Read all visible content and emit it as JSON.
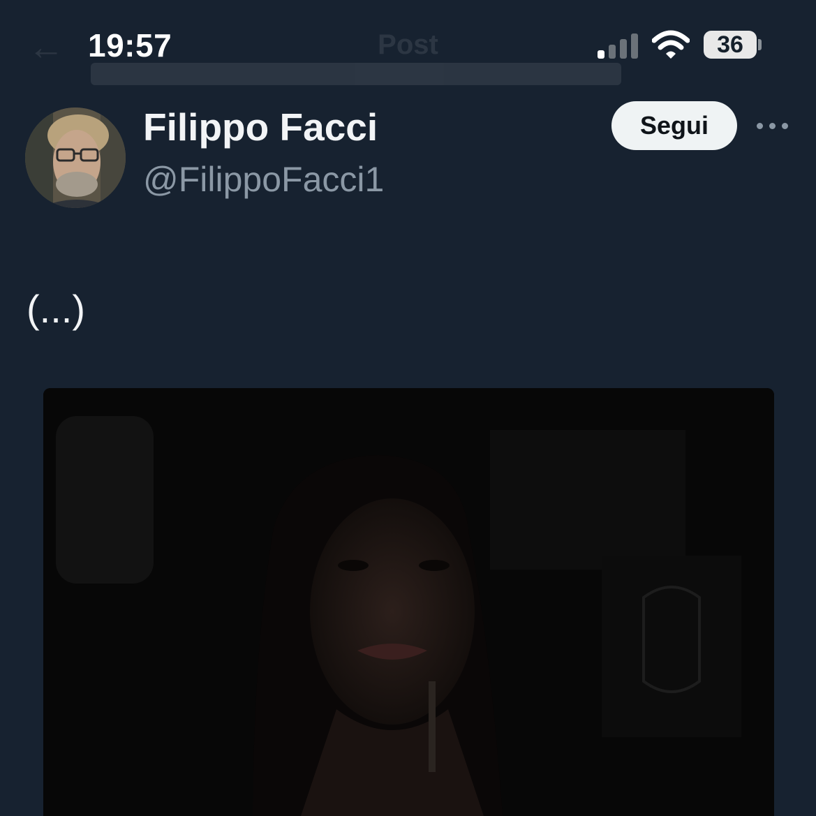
{
  "status_bar": {
    "time": "19:57",
    "battery_level": "36",
    "signal_icon": "cellular-signal-icon",
    "wifi_icon": "wifi-icon",
    "battery_icon": "battery-icon"
  },
  "nav": {
    "title": "Post",
    "back_icon": "back-arrow-icon"
  },
  "post": {
    "author": {
      "display_name": "Filippo Facci",
      "handle": "@FilippoFacci1"
    },
    "follow_label": "Segui",
    "more_icon": "more-dots-icon",
    "text": "(...)"
  },
  "colors": {
    "background": "#15202b",
    "primary_text": "#f2f4f6",
    "secondary_text": "#8b98a5",
    "follow_button_bg": "#eff3f4",
    "follow_button_text": "#0f1419"
  }
}
